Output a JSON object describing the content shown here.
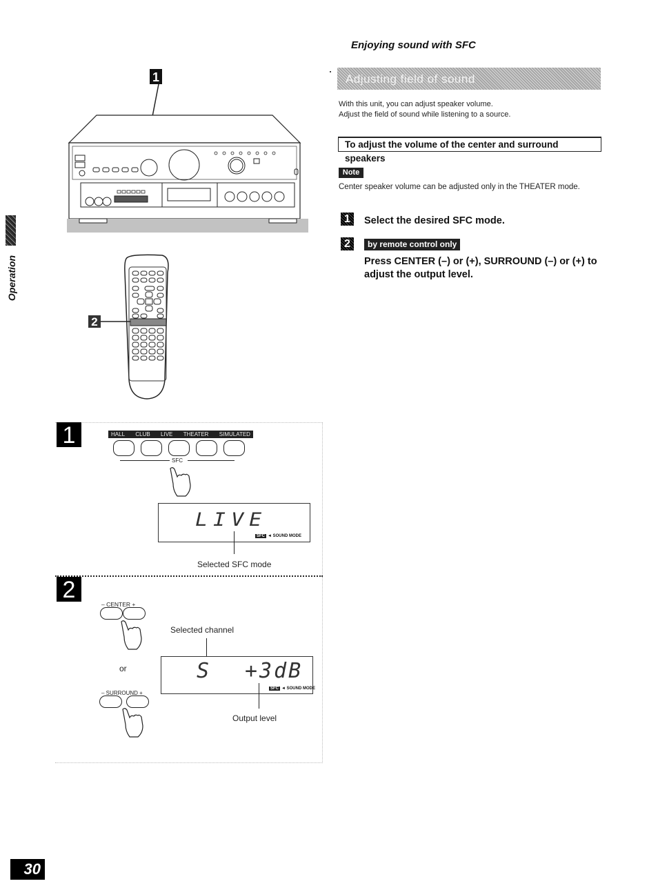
{
  "side_tab": {
    "label": "Operation"
  },
  "page_number": "30",
  "section_title": "Enjoying sound with SFC",
  "heading": "Adjusting field of sound",
  "intro": [
    "With this unit, you can adjust speaker volume.",
    "Adjust the field of sound while listening to a source."
  ],
  "subheading": "To adjust the volume of the center and surround speakers",
  "note": {
    "badge": "Note",
    "text": "Center speaker volume can be adjusted only in the THEATER mode."
  },
  "steps": [
    {
      "num": "1",
      "text": "Select the desired SFC mode."
    },
    {
      "num": "2",
      "badge": "by remote control only",
      "text": "Press CENTER (–) or (+), SURROUND (–) or (+) to adjust the output level."
    }
  ],
  "illustration_callouts": {
    "amplifier": "1",
    "remote": "2"
  },
  "panel1": {
    "num": "1",
    "modes": [
      "HALL",
      "CLUB",
      "LIVE",
      "THEATER",
      "SIMULATED"
    ],
    "group_label": "SFC",
    "display_text": "LIVE",
    "display_tag": {
      "chip": "SFC",
      "label": "◄ SOUND MODE"
    },
    "caption": "Selected SFC mode"
  },
  "panel2": {
    "num": "2",
    "center_label": "– CENTER +",
    "or_label": "or",
    "surround_label": "– SURROUND +",
    "selected_channel_label": "Selected channel",
    "display_channel": "S",
    "display_level": "+3dB",
    "display_tag": {
      "chip": "SFC",
      "label": "◄ SOUND MODE"
    },
    "output_level_label": "Output level"
  }
}
